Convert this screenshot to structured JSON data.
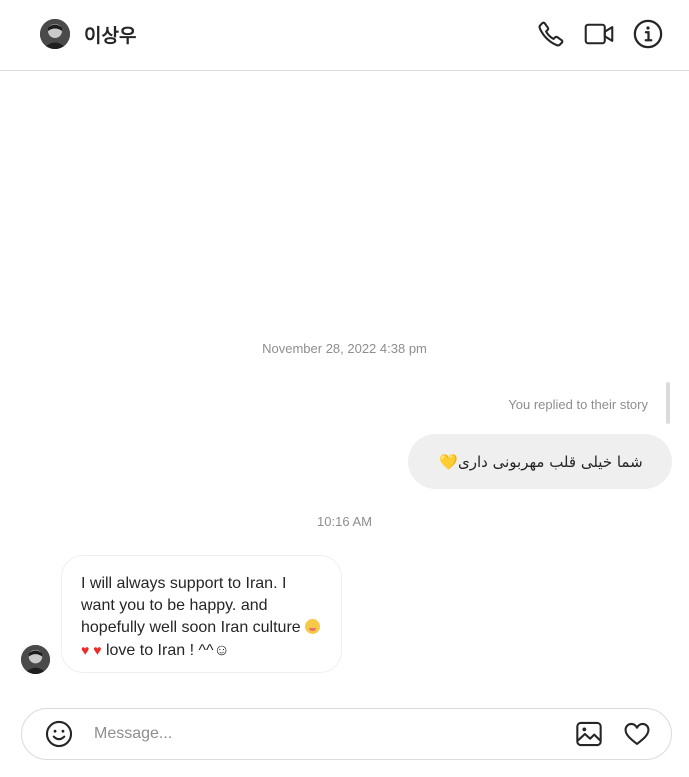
{
  "header": {
    "username": "이상우",
    "avatar_icon": "user-avatar",
    "actions": [
      {
        "name": "phone-icon"
      },
      {
        "name": "video-camera-icon"
      },
      {
        "name": "info-icon"
      }
    ]
  },
  "conversation": {
    "timestamp_1": "November 28, 2022 4:38 pm",
    "story_reply_note": "You replied to their story",
    "outgoing_message": "شما خیلی قلب مهربونی داری",
    "outgoing_heart": "💛",
    "timestamp_2": "10:16 AM",
    "incoming_message_text": "I will always support to Iran. I want you to be happy. and hopefully well soon Iran culture",
    "incoming_message_hearts": "♥ ♥",
    "incoming_message_tail": "love to Iran ! ^^☺"
  },
  "composer": {
    "placeholder": "Message...",
    "icons": [
      "emoji-icon",
      "image-icon",
      "heart-icon"
    ]
  },
  "colors": {
    "border": "#dbdbdb",
    "outgoing_bubble": "#efefef",
    "meta_text": "#8e8e8e",
    "heart_red": "#ed2b2b",
    "heart_yellow": "#f5c518"
  }
}
